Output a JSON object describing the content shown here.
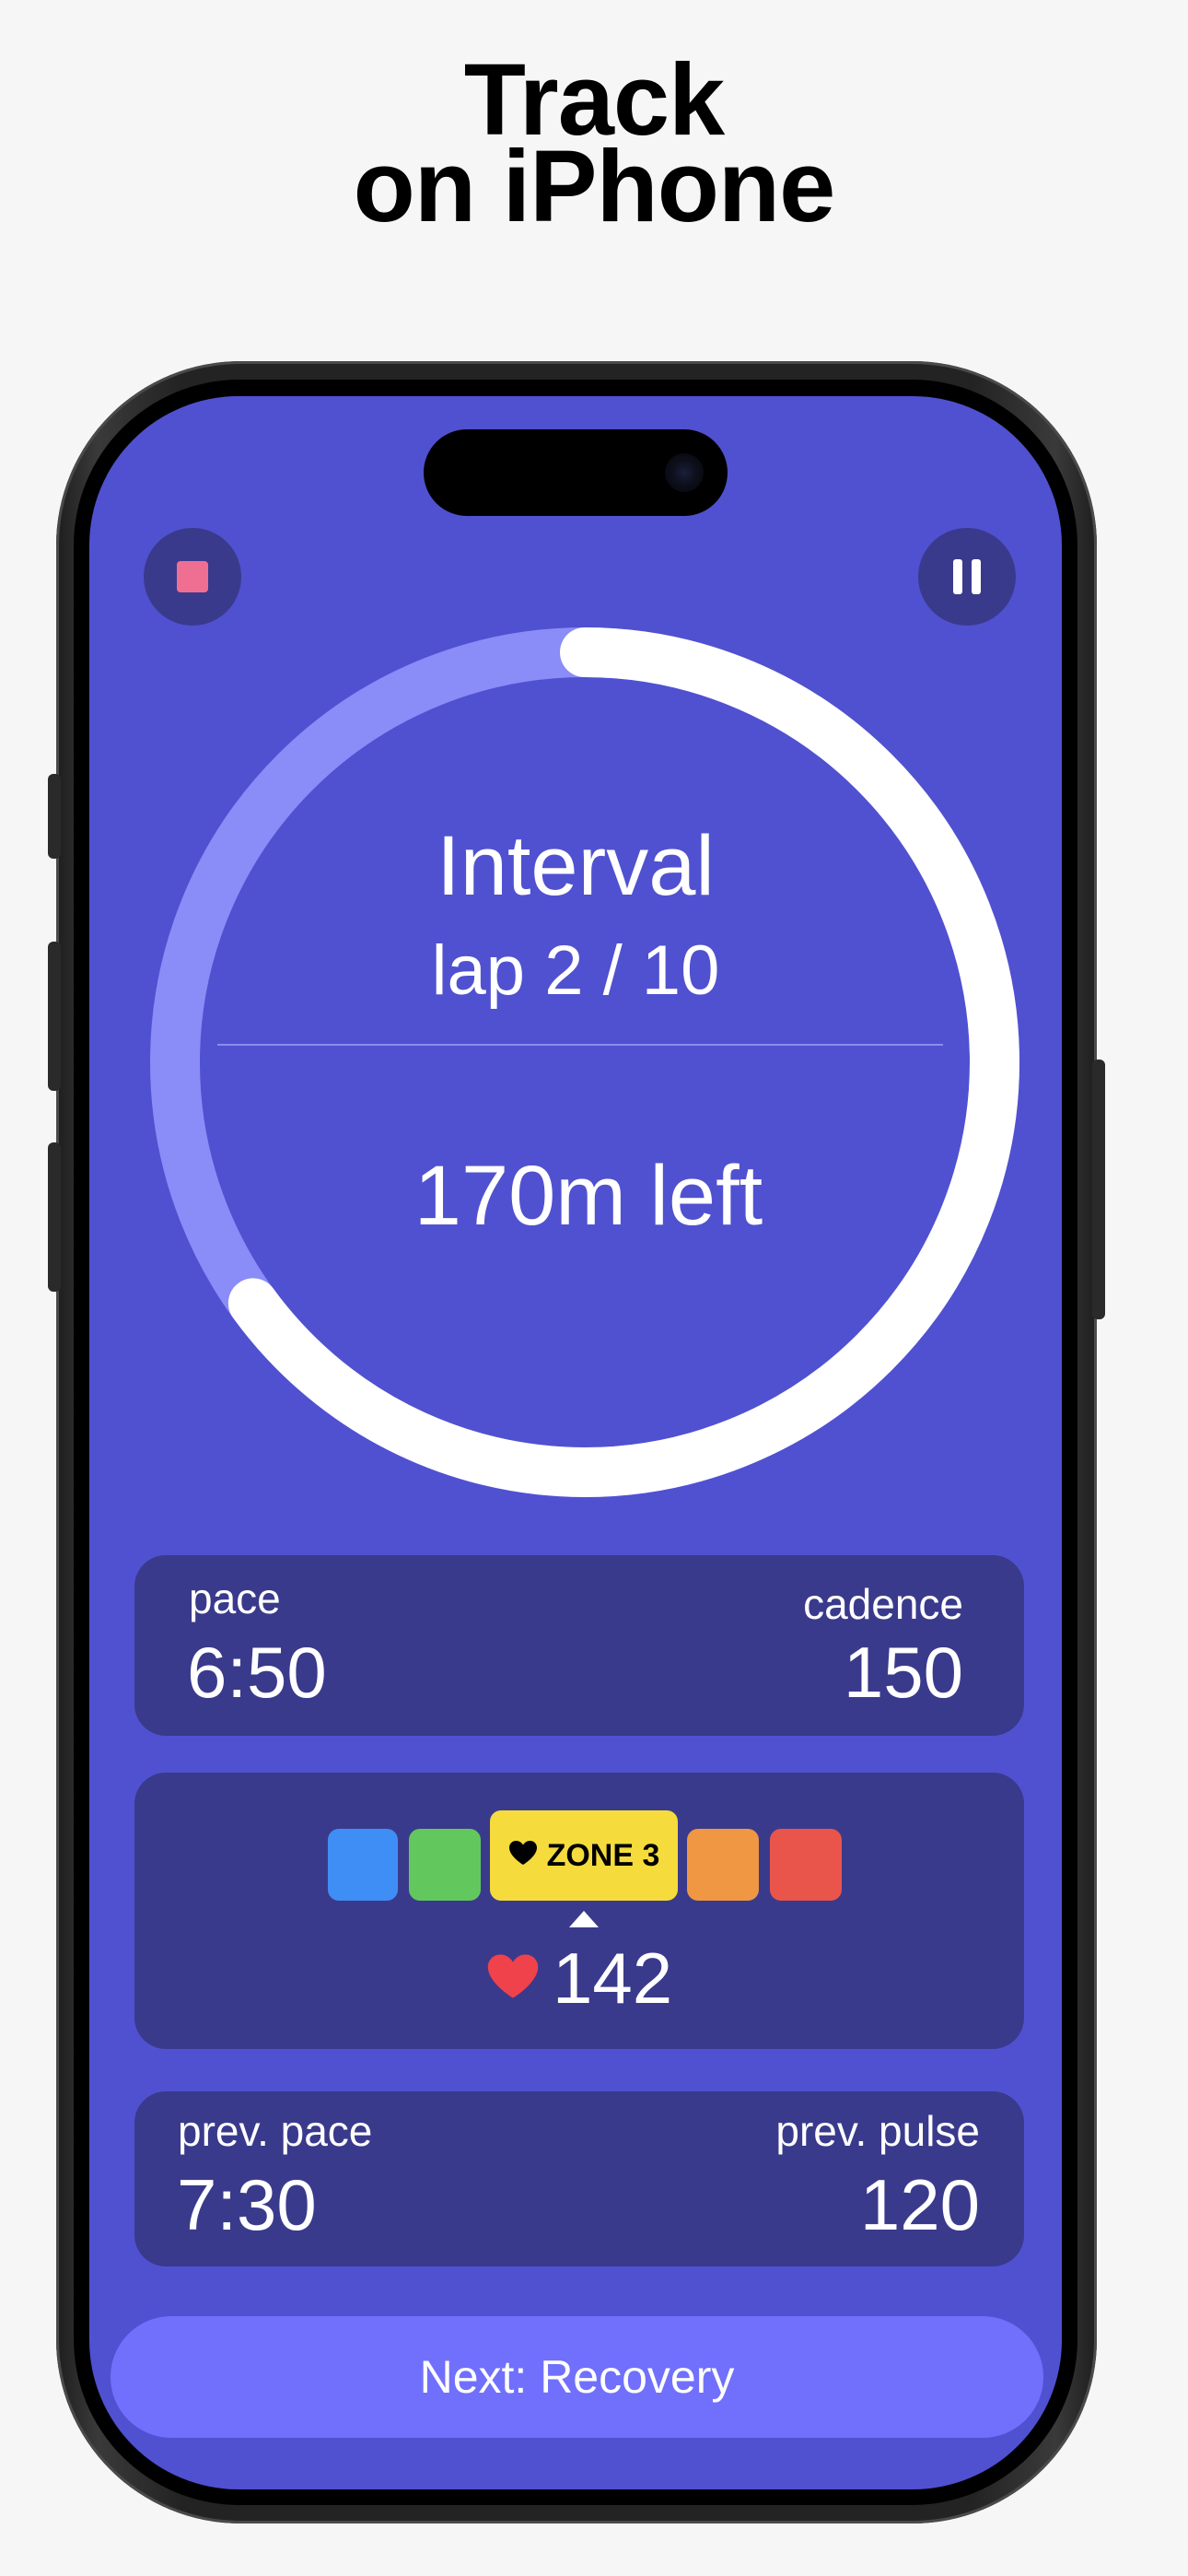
{
  "headline": {
    "line1": "Track",
    "line2": "on iPhone"
  },
  "colors": {
    "screen_bg": "#5051d0",
    "card_bg": "#3a3a8c",
    "ring_done": "#ffffff",
    "ring_remaining": "#8a8cf8",
    "stop": "#ef6f93",
    "button": "#7070fd",
    "heart": "#f0424a"
  },
  "controls": {
    "stop_icon": "stop-square-icon",
    "pause_icon": "pause-icon"
  },
  "workout": {
    "title": "Interval",
    "lap": "lap 2 / 10",
    "remaining": "170m left",
    "progress_fraction": 0.65
  },
  "stats": {
    "pace_label": "pace",
    "pace_value": "6:50",
    "cadence_label": "cadence",
    "cadence_value": "150"
  },
  "heart_rate": {
    "zones": [
      {
        "color": "#3f8ef5"
      },
      {
        "color": "#62c85e"
      },
      {
        "color": "#f5dc3c",
        "label": "ZONE 3",
        "active": true
      },
      {
        "color": "#ef9742"
      },
      {
        "color": "#e9554b"
      }
    ],
    "active_zone_label": "ZONE 3",
    "bpm": "142",
    "heart_icon": "heart-icon"
  },
  "previous": {
    "pace_label": "prev. pace",
    "pace_value": "7:30",
    "pulse_label": "prev. pulse",
    "pulse_value": "120"
  },
  "next_button": {
    "label": "Next: Recovery"
  }
}
